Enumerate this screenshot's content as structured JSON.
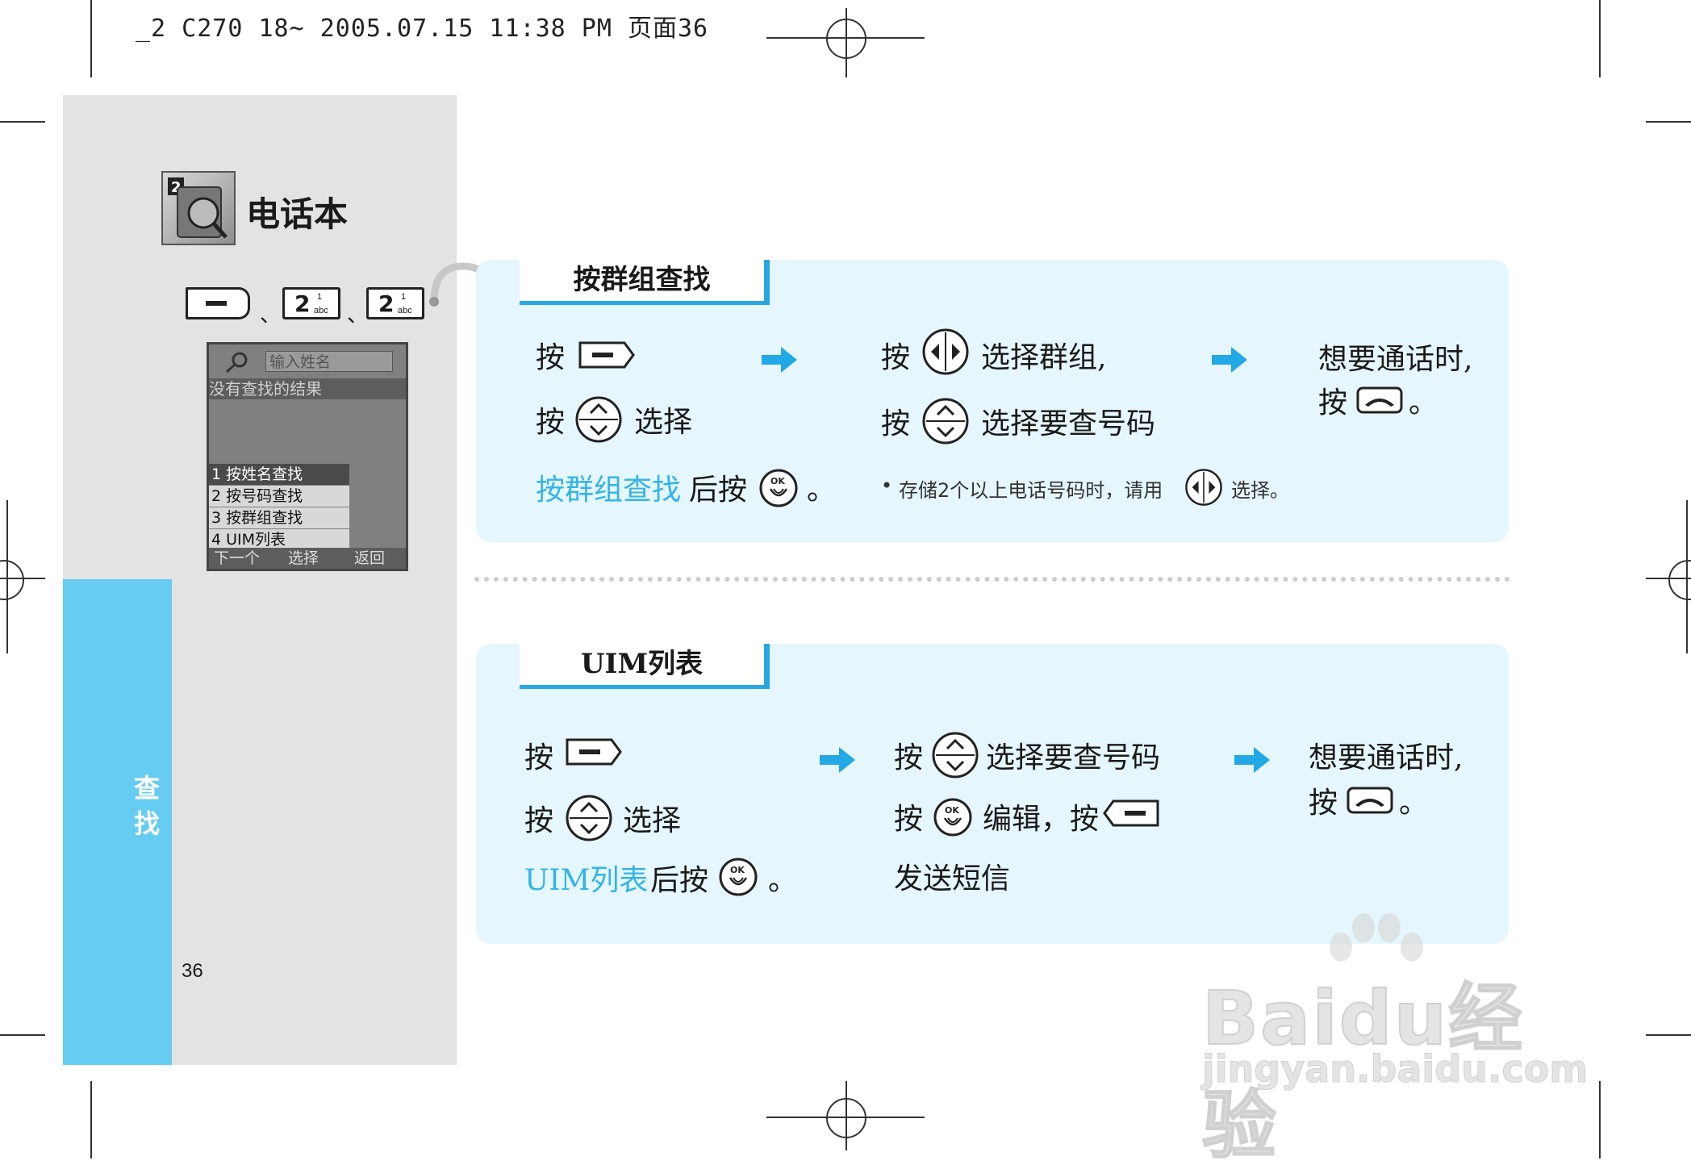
{
  "print_header": "_2 C270 18~ 2005.07.15 11:38 PM 页面36",
  "sidebar": {
    "chapter_title": "电话本",
    "side_tab": [
      "查",
      "找"
    ],
    "page_number": "36",
    "key_sequence": {
      "key_digit": "2",
      "key_sup": "1",
      "key_sub": "abc",
      "separator": "、"
    }
  },
  "phone_screen": {
    "search_placeholder": "输入姓名",
    "no_result": "没有查找的结果",
    "menu_items": [
      "1 按姓名查找",
      "2 按号码查找",
      "3 按群组查找",
      "4 UIM列表"
    ],
    "softkeys": [
      "下一个",
      "选择",
      "返回"
    ]
  },
  "section_group": {
    "title": "按群组查找",
    "step1": {
      "press": "按",
      "select": "选择",
      "highlight": "按群组查找",
      "after_press": "后按",
      "period": "。"
    },
    "step2": {
      "line1_press": "按",
      "line1_text": "选择群组,",
      "line2_press": "按",
      "line2_text": "选择要查号码"
    },
    "step3": {
      "line1": "想要通话时,",
      "line2_press": "按",
      "line2_end": "。"
    },
    "note": {
      "bullet": "•",
      "text_before": "存储2个以上电话号码时，请用",
      "text_after": "选择。"
    }
  },
  "section_uim": {
    "title": "UIM列表",
    "step1": {
      "press": "按",
      "select": "选择",
      "highlight": "UIM列表",
      "after_press": "后按",
      "period": "。"
    },
    "step2": {
      "line1_press": "按",
      "line1_text": "选择要查号码",
      "line2_press": "按",
      "line2_text": "编辑，按",
      "line3": "发送短信"
    },
    "step3": {
      "line1": "想要通话时,",
      "line2_press": "按",
      "line2_end": "。"
    }
  },
  "watermark": {
    "main": "Baidu经验",
    "sub": "jingyan.baidu.com"
  },
  "colors": {
    "accent_blue": "#33b4e6",
    "panel_bg": "#e5f6fc",
    "sidebar_blue": "#66ccf2",
    "sidebar_gray": "#e3e3e3"
  }
}
